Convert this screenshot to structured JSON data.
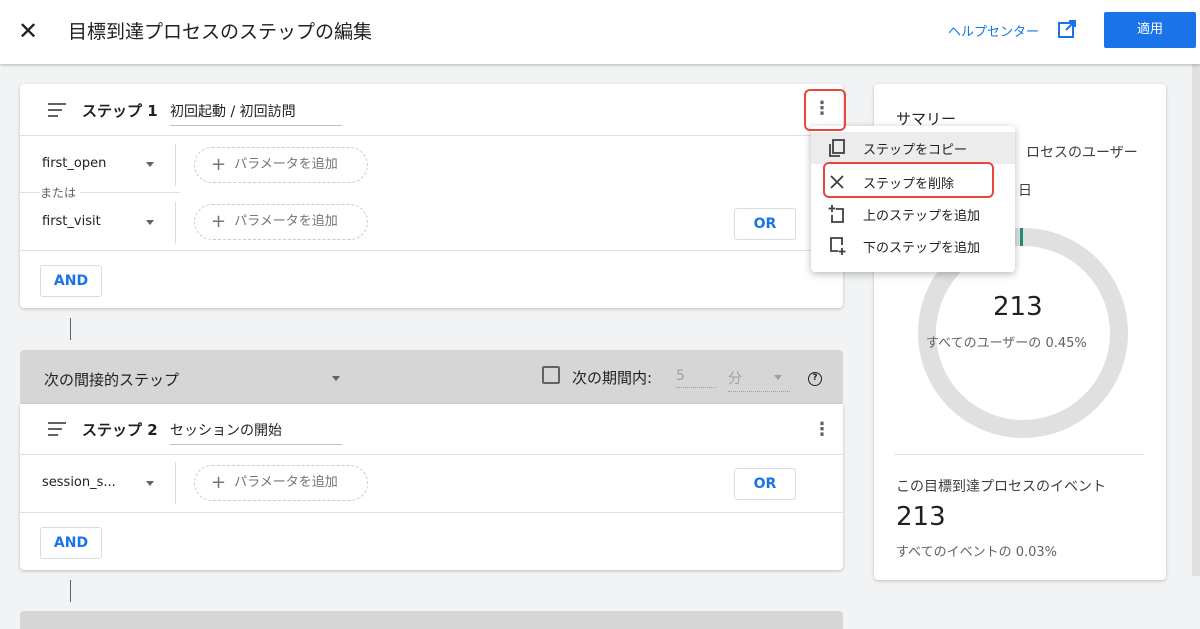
{
  "header": {
    "close_icon": "close-icon",
    "title": "目標到達プロセスのステップの編集",
    "help_label": "ヘルプセンター",
    "help_icon": "open-in-new-icon",
    "apply_label": "適用",
    "accent": "#1a73e8"
  },
  "step1": {
    "label": "ステップ 1",
    "name": "初回起動 / 初回訪問",
    "conditions": [
      {
        "event": "first_open",
        "param_label": "パラメータを追加"
      },
      {
        "event": "first_visit",
        "param_label": "パラメータを追加"
      }
    ],
    "or_text": "または",
    "or_label": "OR",
    "and_label": "AND"
  },
  "indirect": {
    "label": "次の間接的ステップ",
    "period_label": "次の期間内:",
    "period_value": "5",
    "period_unit": "分",
    "help": "?"
  },
  "step2": {
    "label": "ステップ 2",
    "name": "セッションの開始",
    "conditions": [
      {
        "event": "session_s...",
        "param_label": "パラメータを追加"
      }
    ],
    "or_label": "OR",
    "and_label": "AND"
  },
  "menu": {
    "items": [
      {
        "label": "ステップをコピー",
        "icon": "copy-icon"
      },
      {
        "label": "ステップを削除",
        "icon": "close-icon"
      },
      {
        "label": "上のステップを追加",
        "icon": "add-step-above-icon"
      },
      {
        "label": "下のステップを追加",
        "icon": "add-step-below-icon"
      }
    ]
  },
  "summary": {
    "title": "サマリー",
    "users_label_partial": "ロセスのユーザー",
    "date_partial": "日",
    "users_count": "213",
    "users_pct": "すべてのユーザーの 0.45%",
    "users_fraction": 0.0045,
    "events_label": "この目標到達プロセスのイベント",
    "events_count": "213",
    "events_pct": "すべてのイベントの 0.03%",
    "donut_color": "#e0e0e0",
    "donut_fill_color": "#1e8e7e"
  },
  "annotation_color": "#e8473b"
}
